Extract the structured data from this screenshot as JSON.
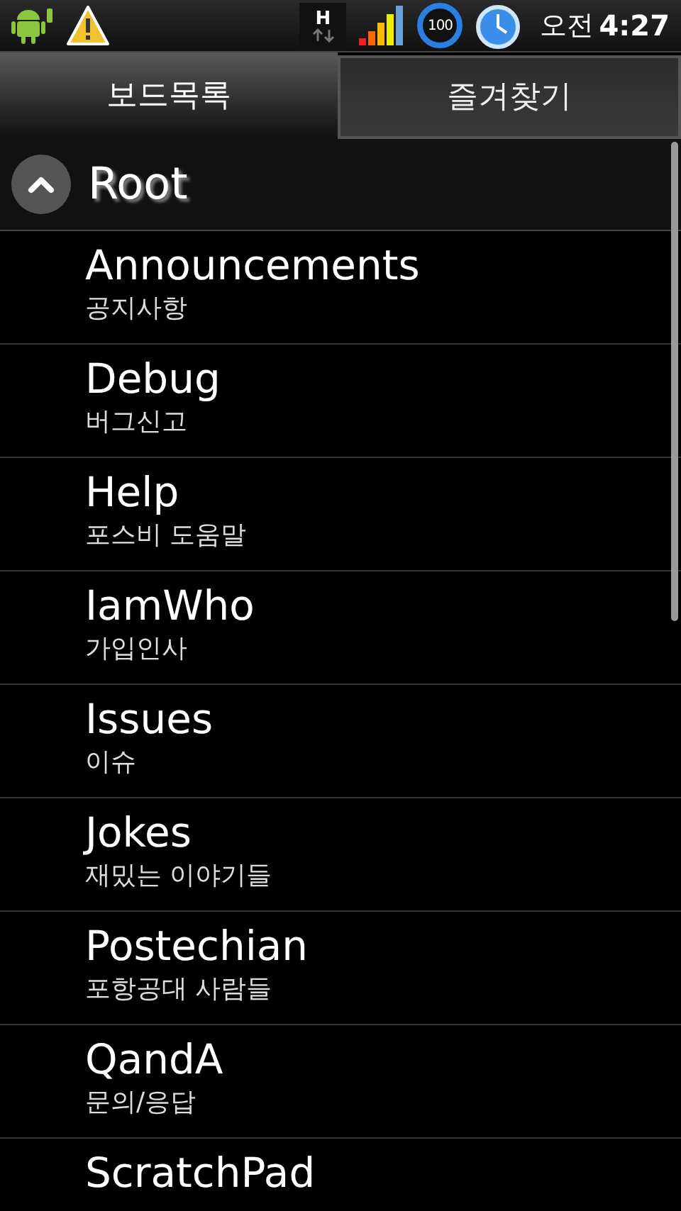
{
  "status_bar": {
    "network_label": "H",
    "battery": "100",
    "period": "오전",
    "time": "4:27"
  },
  "tabs": [
    {
      "label": "보드목록",
      "selected": true
    },
    {
      "label": "즐겨찾기",
      "selected": false
    }
  ],
  "header": {
    "title": "Root"
  },
  "boards": [
    {
      "name": "Announcements",
      "description": "공지사항"
    },
    {
      "name": "Debug",
      "description": "버그신고"
    },
    {
      "name": "Help",
      "description": "포스비 도움말"
    },
    {
      "name": "IamWho",
      "description": "가입인사"
    },
    {
      "name": "Issues",
      "description": "이슈"
    },
    {
      "name": "Jokes",
      "description": "재밌는 이야기들"
    },
    {
      "name": "Postechian",
      "description": "포항공대 사람들"
    },
    {
      "name": "QandA",
      "description": "문의/응답"
    },
    {
      "name": "ScratchPad"
    }
  ]
}
